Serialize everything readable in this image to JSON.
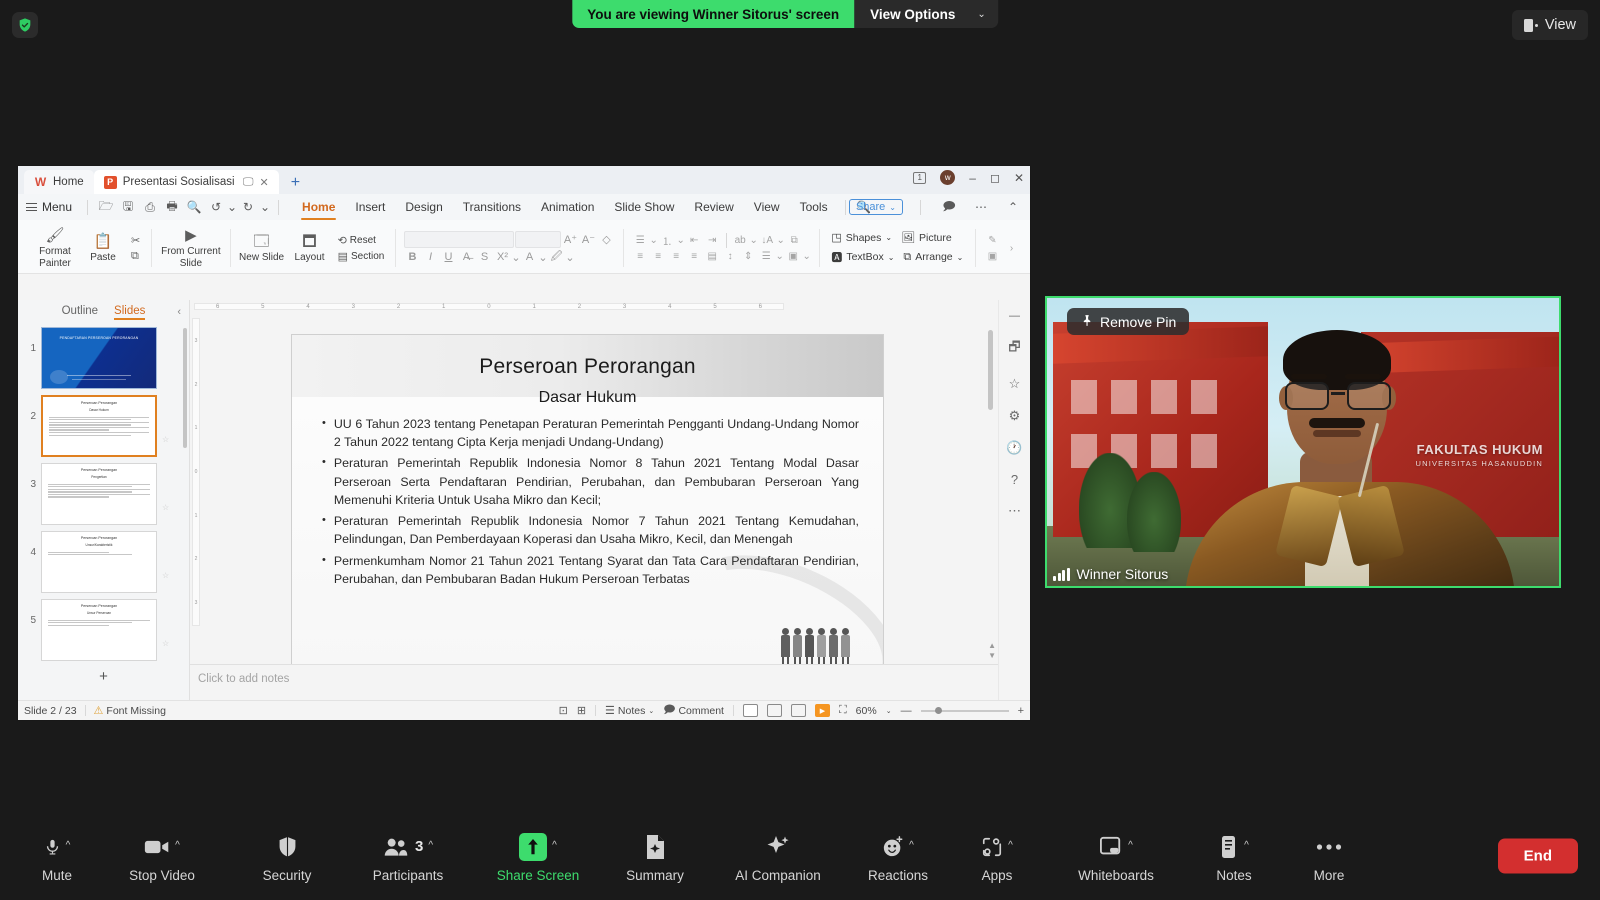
{
  "zoom_top": {
    "security_icon": "shield-check-icon",
    "viewing_banner": "You are viewing Winner Sitorus' screen",
    "view_options": "View Options",
    "view_toggle": "View"
  },
  "wps": {
    "tabs": [
      {
        "label": "Home",
        "icon": "wps-logo-icon"
      },
      {
        "label": "Presentasi Sosialisasi Perseroan",
        "icon": "powerpoint-icon"
      }
    ],
    "new_tab": "+",
    "menu_button": "Menu",
    "ribbon_tabs": [
      "Home",
      "Insert",
      "Design",
      "Transitions",
      "Animation",
      "Slide Show",
      "Review",
      "View",
      "Tools"
    ],
    "active_ribbon_tab": "Home",
    "share_button": "Share",
    "window_doc_count": "1",
    "avatar_initial": "w",
    "ribbon": {
      "clipboard": [
        {
          "label": "Format Painter",
          "icon": "format-painter-icon"
        },
        {
          "label": "Paste",
          "icon": "paste-icon"
        },
        {
          "label": "Cut",
          "icon": "scissors-icon"
        },
        {
          "label": "Copy",
          "icon": "copy-icon"
        }
      ],
      "slideshow": [
        {
          "label": "From Current Slide",
          "icon": "play-circle-icon"
        }
      ],
      "slides": [
        {
          "label": "New Slide",
          "icon": "new-slide-icon"
        },
        {
          "label": "Layout",
          "icon": "layout-icon"
        },
        {
          "label": "Reset",
          "icon": "reset-icon"
        },
        {
          "label": "Section",
          "icon": "section-icon"
        }
      ],
      "font_name": "",
      "font_size": "",
      "objects": [
        {
          "label": "Shapes",
          "icon": "shapes-icon"
        },
        {
          "label": "Picture",
          "icon": "picture-icon"
        },
        {
          "label": "TextBox",
          "icon": "textbox-icon"
        },
        {
          "label": "Arrange",
          "icon": "arrange-icon"
        }
      ]
    },
    "panes": {
      "outline_tab": "Outline",
      "slides_tab": "Slides",
      "active_pane_tab": "Slides"
    },
    "thumbnails": [
      {
        "number": "1",
        "title": "PENDAFTARAN PERSEROAN PERORANGAN",
        "selected": false,
        "cover": true
      },
      {
        "number": "2",
        "title": "Perseroan Perorangan",
        "subtitle": "Dasar Hukum",
        "selected": true
      },
      {
        "number": "3",
        "title": "Perseroan Perorangan",
        "subtitle": "Pengertian",
        "selected": false
      },
      {
        "number": "4",
        "title": "Perseroan Perorangan",
        "subtitle": "Unsur/Karakteristik",
        "selected": false
      },
      {
        "number": "5",
        "title": "Perseroan Perorangan",
        "subtitle": "Unsur Perseroan",
        "selected": false
      }
    ],
    "add_slide": "+",
    "slide": {
      "title": "Perseroan Perorangan",
      "subtitle": "Dasar Hukum",
      "bullets": [
        "UU 6 Tahun 2023 tentang Penetapan Peraturan Pemerintah Pengganti Undang-Undang Nomor 2 Tahun 2022 tentang Cipta Kerja menjadi Undang-Undang)",
        "Peraturan Pemerintah Republik Indonesia Nomor 8 Tahun 2021 Tentang Modal Dasar Perseroan Serta Pendaftaran Pendirian, Perubahan, dan Pembubaran Perseroan Yang Memenuhi Kriteria Untuk Usaha Mikro dan Kecil;",
        "Peraturan Pemerintah Republik Indonesia Nomor 7 Tahun 2021 Tentang Kemudahan, Pelindungan, Dan Pemberdayaan Koperasi dan Usaha Mikro, Kecil, dan Menengah",
        "Permenkumham Nomor 21 Tahun 2021 Tentang Syarat dan Tata Cara Pendaftaran Pendirian, Perubahan, dan Pembubaran Badan Hukum Perseroan Terbatas"
      ]
    },
    "notes_placeholder": "Click to add notes",
    "status": {
      "slide_indicator": "Slide 2 / 23",
      "font_missing": "Font Missing",
      "notes_button": "Notes",
      "comment_button": "Comment",
      "zoom_level": "60%"
    },
    "ruler_h": [
      "6",
      "5",
      "4",
      "3",
      "2",
      "1",
      "0",
      "1",
      "2",
      "3",
      "4",
      "5",
      "6"
    ],
    "ruler_v": [
      "3",
      "2",
      "1",
      "0",
      "1",
      "2",
      "3"
    ],
    "right_rail_icons": [
      "shapes-panel-icon",
      "favorites-star-icon",
      "settings-sliders-icon",
      "history-clock-icon",
      "help-circle-icon",
      "more-dots-icon"
    ]
  },
  "video": {
    "remove_pin_label": "Remove Pin",
    "remove_pin_icon": "pin-icon",
    "participant_name": "Winner Sitorus",
    "audio_icon": "audio-bars-icon",
    "background_text": "FAKULTAS HUKUM",
    "background_subtext": "UNIVERSITAS HASANUDDIN"
  },
  "zoom_bottom": {
    "items": [
      {
        "label": "Mute",
        "icon": "microphone-icon",
        "caret": true,
        "green": false
      },
      {
        "label": "Stop Video",
        "icon": "video-camera-icon",
        "caret": true,
        "green": false
      },
      {
        "label": "Security",
        "icon": "shield-icon",
        "caret": false,
        "green": false
      },
      {
        "label": "Participants",
        "icon": "participants-icon",
        "caret": true,
        "green": false,
        "badge": "3"
      },
      {
        "label": "Share Screen",
        "icon": "share-screen-icon",
        "caret": true,
        "green": true
      },
      {
        "label": "Summary",
        "icon": "summary-doc-icon",
        "caret": false,
        "green": false
      },
      {
        "label": "AI Companion",
        "icon": "ai-sparkle-icon",
        "caret": false,
        "green": false
      },
      {
        "label": "Reactions",
        "icon": "reactions-smiley-icon",
        "caret": true,
        "green": false
      },
      {
        "label": "Apps",
        "icon": "apps-icon",
        "caret": true,
        "green": false
      },
      {
        "label": "Whiteboards",
        "icon": "whiteboard-icon",
        "caret": true,
        "green": false
      },
      {
        "label": "Notes",
        "icon": "notes-icon",
        "caret": true,
        "green": false
      },
      {
        "label": "More",
        "icon": "more-dots-icon",
        "caret": false,
        "green": false
      }
    ],
    "end_button": "End"
  },
  "colors": {
    "zoom_green": "#3ddc6d",
    "end_red": "#d32f2f",
    "wps_orange": "#e08020",
    "dark_bg": "#1a1a1a"
  }
}
